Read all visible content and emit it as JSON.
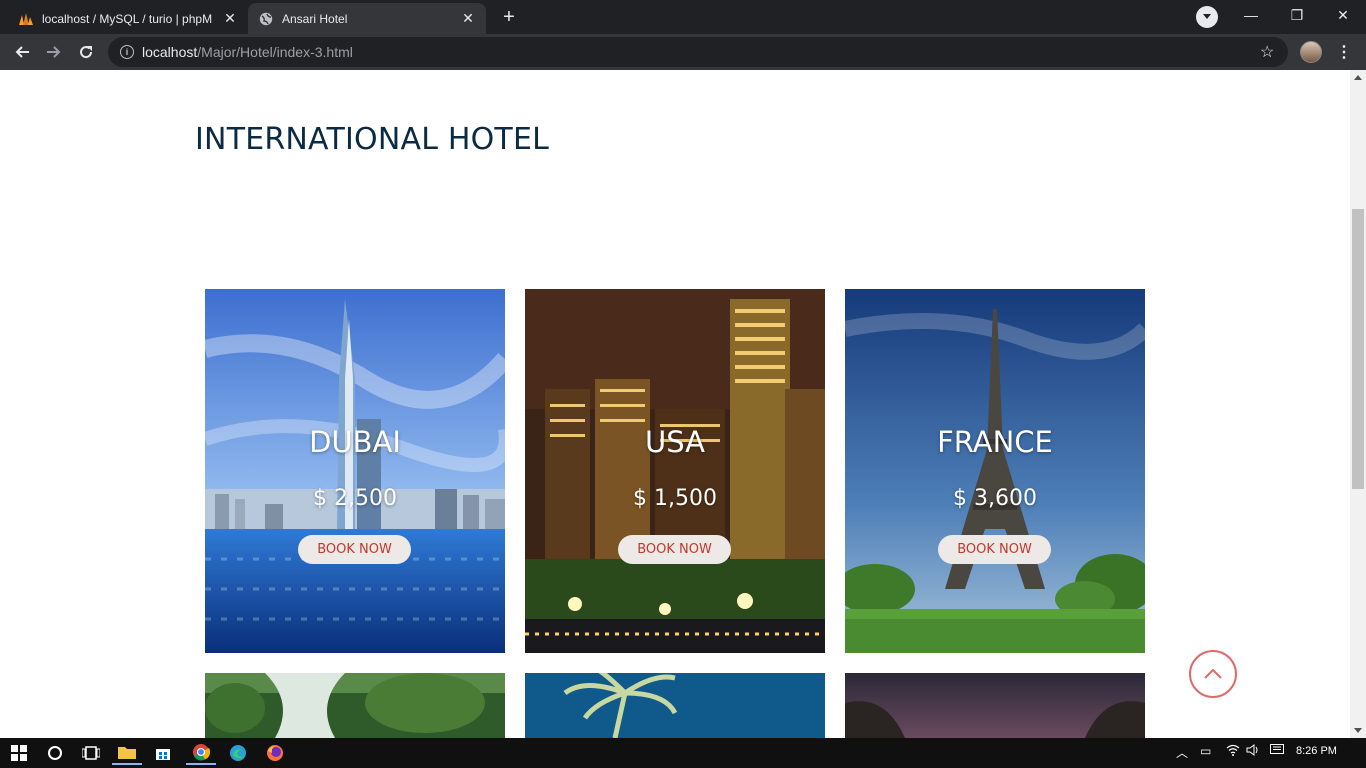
{
  "browser": {
    "tabs": [
      {
        "title": "localhost / MySQL / turio | phpM",
        "active": false,
        "icon": "phpmyadmin-icon"
      },
      {
        "title": "Ansari Hotel",
        "active": true,
        "icon": "globe-icon"
      }
    ],
    "address": {
      "host": "localhost",
      "path": "/Major/Hotel/index-3.html"
    }
  },
  "page": {
    "heading": "INTERNATIONAL HOTEL",
    "cards": [
      {
        "city": "DUBAI",
        "price": "$ 2,500",
        "button": "BOOK NOW",
        "theme": "dubai"
      },
      {
        "city": "USA",
        "price": "$ 1,500",
        "button": "BOOK NOW",
        "theme": "usa"
      },
      {
        "city": "FRANCE",
        "price": "$ 3,600",
        "button": "BOOK NOW",
        "theme": "france"
      }
    ],
    "scroll_top_icon": "chevron-up-icon",
    "colors": {
      "heading": "#0b2a44",
      "button_text": "#c0392b",
      "scroll_ring": "#e06a66"
    }
  },
  "taskbar": {
    "time": "8:26 PM"
  }
}
